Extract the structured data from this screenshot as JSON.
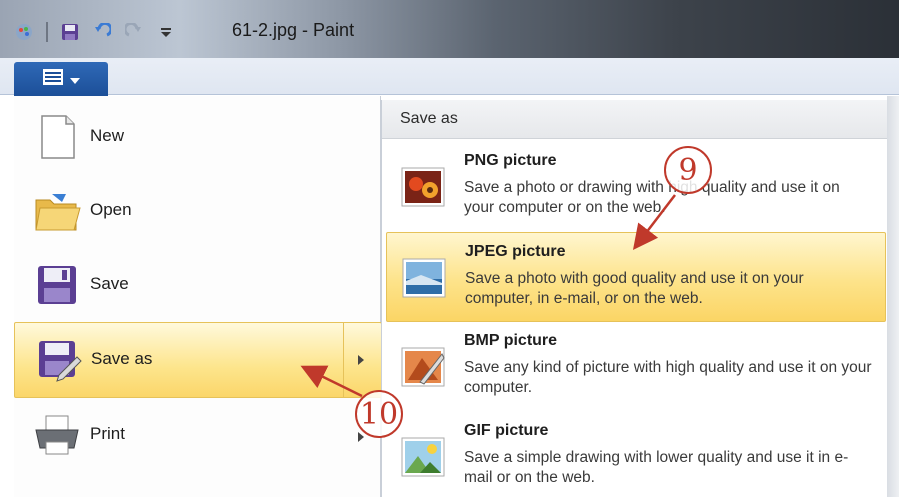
{
  "window": {
    "title": "61-2.jpg - Paint"
  },
  "quick_access": [
    "paint-app-icon",
    "save-icon",
    "undo-icon",
    "redo-icon",
    "customize-dropdown-icon"
  ],
  "app_menu": {
    "button_icon": "menu-icon",
    "items": [
      {
        "label": "New",
        "icon": "new-document-icon"
      },
      {
        "label": "Open",
        "icon": "open-folder-icon"
      },
      {
        "label": "Save",
        "icon": "save-disk-icon"
      },
      {
        "label": "Save as",
        "icon": "save-as-icon",
        "highlighted": true,
        "has_submenu": true
      },
      {
        "label": "Print",
        "icon": "printer-icon",
        "has_submenu": true
      }
    ]
  },
  "submenu": {
    "header": "Save as",
    "items": [
      {
        "title": "PNG picture",
        "desc": "Save a photo or drawing with high quality and use it on your computer or on the web.",
        "icon": "png-picture-icon"
      },
      {
        "title": "JPEG picture",
        "desc": "Save a photo with good quality and use it on your computer, in e-mail, or on the web.",
        "icon": "jpeg-picture-icon",
        "highlighted": true
      },
      {
        "title": "BMP picture",
        "desc": "Save any kind of picture with high quality and use it on your computer.",
        "icon": "bmp-picture-icon"
      },
      {
        "title": "GIF picture",
        "desc": "Save a simple drawing with lower quality and use it in e-mail or on the web.",
        "icon": "gif-picture-icon"
      }
    ]
  },
  "callouts": [
    {
      "number": "9",
      "points_to": "JPEG picture"
    },
    {
      "number": "10",
      "points_to": "Save as"
    }
  ],
  "colors": {
    "highlight": "#fde38a",
    "highlight_border": "#e6c25a",
    "menu_button": "#1c4f98",
    "callout": "#c0392b"
  }
}
